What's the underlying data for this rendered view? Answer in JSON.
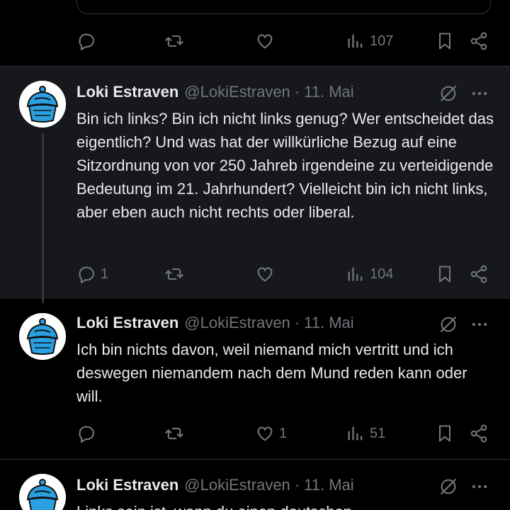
{
  "tweets": [
    {
      "name": "Loki Estraven",
      "handle": "@LokiEstraven",
      "date": "11. Mai",
      "text": "Bin ich links? Bin ich nicht links genug? Wer entscheidet das eigentlich? Und was hat der willkürliche Bezug auf eine Sitzordnung von vor 250 Jahreb irgendeine zu verteidigende Bedeutung im 21. Jahrhundert? Vielleicht bin ich nicht links, aber eben auch nicht rechts oder liberal.",
      "replies": "1",
      "retweets": "",
      "likes": "",
      "views": "104"
    },
    {
      "name": "Loki Estraven",
      "handle": "@LokiEstraven",
      "date": "11. Mai",
      "text": "Ich bin nichts davon, weil niemand mich vertritt und ich deswegen niemandem nach dem Mund reden kann oder will.",
      "replies": "",
      "retweets": "",
      "likes": "1",
      "views": "51"
    },
    {
      "name": "Loki Estraven",
      "handle": "@LokiEstraven",
      "date": "11. Mai",
      "text": "Links sein ist, wenn du einen deutschen"
    }
  ],
  "top_actions": {
    "views": "107"
  },
  "separator": "·",
  "icons": {
    "reply": "reply-icon",
    "retweet": "retweet-icon",
    "like": "heart-icon",
    "views": "bar-chart-icon",
    "bookmark": "bookmark-icon",
    "share": "share-icon",
    "grok": "grok-icon",
    "more": "more-icon"
  },
  "colors": {
    "background": "#000000",
    "highlight_background": "#16181c",
    "text": "#e7e9ea",
    "muted": "#71767b",
    "border": "#2f3336",
    "avatar_blue": "#2aa0e0"
  }
}
